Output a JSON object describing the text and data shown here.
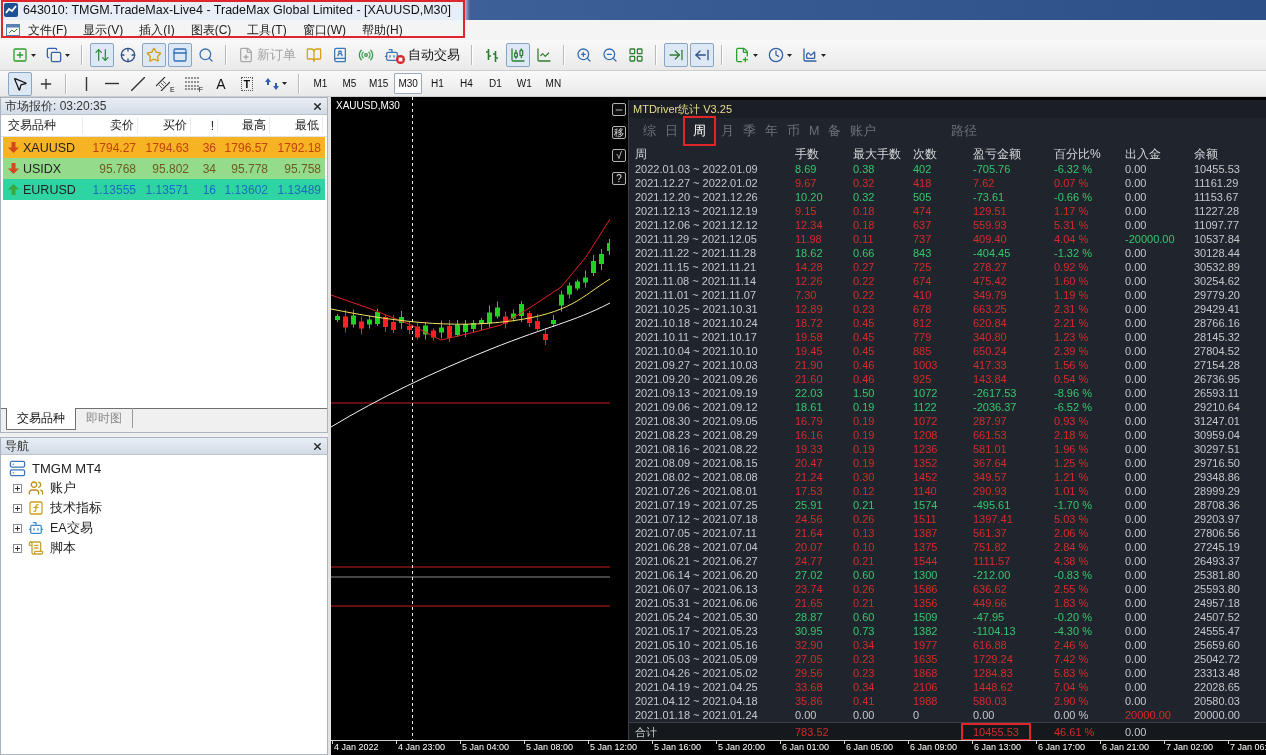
{
  "window": {
    "title": "643010: TMGM.TradeMax-Live4 - TradeMax Global Limited - [XAUUSD,M30]",
    "marked": true
  },
  "menu": [
    "文件(F)",
    "显示(V)",
    "插入(I)",
    "图表(C)",
    "工具(T)",
    "窗口(W)",
    "帮助(H)"
  ],
  "toolbar": {
    "groups": [
      [
        {
          "kind": "icon",
          "pressed": false
        },
        {
          "kind": "icon",
          "pressed": false
        }
      ],
      [
        {
          "kind": "icon",
          "pressed": true
        },
        {
          "kind": "icon",
          "pressed": false
        },
        {
          "kind": "icon",
          "pressed": true
        },
        {
          "kind": "icon",
          "pressed": true
        },
        {
          "kind": "icon",
          "pressed": false
        }
      ],
      [
        {
          "kind": "text",
          "label": "新订单",
          "disabled": true
        },
        {
          "kind": "icon",
          "pressed": false
        },
        {
          "kind": "icon",
          "pressed": false
        },
        {
          "kind": "icon",
          "pressed": false
        },
        {
          "kind": "text",
          "label": "自动交易",
          "disabled": false,
          "on": false
        }
      ],
      [
        {
          "kind": "icon",
          "pressed": false
        },
        {
          "kind": "icon",
          "pressed": true
        },
        {
          "kind": "icon",
          "pressed": false
        }
      ],
      [
        {
          "kind": "icon",
          "pressed": false
        },
        {
          "kind": "icon",
          "pressed": false
        },
        {
          "kind": "icon",
          "pressed": false
        }
      ],
      [
        {
          "kind": "icon",
          "pressed": true
        },
        {
          "kind": "icon",
          "pressed": true
        }
      ],
      [
        {
          "kind": "icon",
          "pressed": false
        },
        {
          "kind": "icon",
          "pressed": false
        },
        {
          "kind": "icon",
          "pressed": false
        }
      ]
    ]
  },
  "drawing_toolbar": {
    "groups": [
      [
        {
          "kind": "icon",
          "pressed": true
        },
        {
          "kind": "icon",
          "pressed": false
        }
      ],
      [
        {
          "kind": "icon",
          "pressed": false
        },
        {
          "kind": "icon",
          "pressed": false
        },
        {
          "kind": "icon",
          "pressed": false
        },
        {
          "kind": "icon",
          "pressed": false,
          "sub": "E"
        },
        {
          "kind": "icon",
          "pressed": false,
          "sub": "F"
        },
        {
          "kind": "letter",
          "label": "A",
          "pressed": false
        },
        {
          "kind": "boxed",
          "label": "T",
          "pressed": false
        },
        {
          "kind": "icon",
          "pressed": false
        }
      ]
    ],
    "periods": [
      {
        "label": "M1",
        "selected": false
      },
      {
        "label": "M5",
        "selected": false
      },
      {
        "label": "M15",
        "selected": false
      },
      {
        "label": "M30",
        "selected": true
      },
      {
        "label": "H1",
        "selected": false
      },
      {
        "label": "H4",
        "selected": false
      },
      {
        "label": "D1",
        "selected": false
      },
      {
        "label": "W1",
        "selected": false
      },
      {
        "label": "MN",
        "selected": false
      }
    ]
  },
  "market_watch": {
    "title": "市场报价: 03:20:35",
    "columns": [
      "交易品种",
      "卖价",
      "买价",
      "!",
      "最高",
      "最低"
    ],
    "rows": [
      {
        "symbol": "XAUUSD",
        "kind": "down",
        "color": "#f6b324",
        "quote": {
          "color": "#c2410f",
          "bid": "1794.27",
          "ask": "1794.63",
          "spread": "36",
          "high": "1796.57",
          "low": "1792.18"
        }
      },
      {
        "symbol": "USIDX",
        "kind": "down",
        "color": "#94db8b",
        "quote": {
          "color": "#6e5b22",
          "bid": "95.768",
          "ask": "95.802",
          "spread": "34",
          "high": "95.778",
          "low": "95.758"
        }
      },
      {
        "symbol": "EURUSD",
        "kind": "up",
        "color": "#2ed5a3",
        "quote": {
          "color": "#1c6cb8",
          "bid": "1.13555",
          "ask": "1.13571",
          "spread": "16",
          "high": "1.13602",
          "low": "1.13489"
        }
      }
    ],
    "tabs": [
      {
        "label": "交易品种",
        "selected": true
      },
      {
        "label": "即时图",
        "selected": false
      }
    ]
  },
  "navigator": {
    "title": "导航",
    "root": {
      "label": "TMGM MT4",
      "children": [
        {
          "label": "账户",
          "expanded": false
        },
        {
          "label": "技术指标",
          "expanded": false
        },
        {
          "label": "EA交易",
          "expanded": false
        },
        {
          "label": "脚本",
          "expanded": false
        }
      ]
    }
  },
  "chart": {
    "label": "XAUUSD,M30",
    "side_buttons": [
      {
        "kind": "icon"
      },
      {
        "kind": "text",
        "label": "移"
      },
      {
        "kind": "text",
        "label": "√"
      },
      {
        "kind": "text",
        "label": "?"
      }
    ],
    "time_labels": [
      "4 Jan 2022",
      "4 Jan 23:00",
      "5 Jan 04:00",
      "5 Jan 08:00",
      "5 Jan 12:00",
      "5 Jan 16:00",
      "5 Jan 20:00",
      "6 Jan 01:00",
      "6 Jan 05:00",
      "6 Jan 09:00",
      "6 Jan 13:00",
      "6 Jan 17:00",
      "6 Jan 21:00",
      "7 Jan 02:00",
      "7 Jan 06:"
    ]
  },
  "stats": {
    "title": "MTDriver统计 V3.25",
    "tabs": [
      {
        "label": "综",
        "selected": false,
        "marked": false
      },
      {
        "label": "日",
        "selected": false,
        "marked": false
      },
      {
        "label": "周",
        "selected": true,
        "marked": true
      },
      {
        "label": "月",
        "selected": false,
        "marked": false
      },
      {
        "label": "季",
        "selected": false,
        "marked": false
      },
      {
        "label": "年",
        "selected": false,
        "marked": false
      },
      {
        "label": "币",
        "selected": false,
        "marked": false
      },
      {
        "label": "M",
        "selected": false,
        "marked": false
      },
      {
        "label": "备",
        "selected": false,
        "marked": false
      },
      {
        "label": "账户",
        "selected": false,
        "marked": false
      },
      {
        "label": "路径",
        "selected": false,
        "marked": false
      }
    ],
    "columns": [
      "周",
      "手数",
      "最大手数",
      "次数",
      "盈亏金额",
      "百分比%",
      "出入金",
      "余额"
    ],
    "rows": [
      {
        "week": "2022.01.03 ~ 2022.01.09",
        "lots": "8.69",
        "max_lots": "0.38",
        "trades": "402",
        "profit": "-705.76",
        "percent": "-6.32 %",
        "deposit": {
          "value": "0.00",
          "kind": "none"
        },
        "balance": "10455.53",
        "kind": "loss"
      },
      {
        "week": "2021.12.27 ~ 2022.01.02",
        "lots": "9.67",
        "max_lots": "0.32",
        "trades": "418",
        "profit": "7.62",
        "percent": "0.07 %",
        "deposit": {
          "value": "0.00",
          "kind": "none"
        },
        "balance": "11161.29",
        "kind": "gain"
      },
      {
        "week": "2021.12.20 ~ 2021.12.26",
        "lots": "10.20",
        "max_lots": "0.32",
        "trades": "505",
        "profit": "-73.61",
        "percent": "-0.66 %",
        "deposit": {
          "value": "0.00",
          "kind": "none"
        },
        "balance": "11153.67",
        "kind": "loss"
      },
      {
        "week": "2021.12.13 ~ 2021.12.19",
        "lots": "9.15",
        "max_lots": "0.18",
        "trades": "474",
        "profit": "129.51",
        "percent": "1.17 %",
        "deposit": {
          "value": "0.00",
          "kind": "none"
        },
        "balance": "11227.28",
        "kind": "gain"
      },
      {
        "week": "2021.12.06 ~ 2021.12.12",
        "lots": "12.34",
        "max_lots": "0.18",
        "trades": "637",
        "profit": "559.93",
        "percent": "5.31 %",
        "deposit": {
          "value": "0.00",
          "kind": "none"
        },
        "balance": "11097.77",
        "kind": "gain"
      },
      {
        "week": "2021.11.29 ~ 2021.12.05",
        "lots": "11.98",
        "max_lots": "0.11",
        "trades": "737",
        "profit": "409.40",
        "percent": "4.04 %",
        "deposit": {
          "value": "-20000.00",
          "kind": "out"
        },
        "balance": "10537.84",
        "kind": "gain"
      },
      {
        "week": "2021.11.22 ~ 2021.11.28",
        "lots": "18.62",
        "max_lots": "0.66",
        "trades": "843",
        "profit": "-404.45",
        "percent": "-1.32 %",
        "deposit": {
          "value": "0.00",
          "kind": "none"
        },
        "balance": "30128.44",
        "kind": "loss"
      },
      {
        "week": "2021.11.15 ~ 2021.11.21",
        "lots": "14.28",
        "max_lots": "0.27",
        "trades": "725",
        "profit": "278.27",
        "percent": "0.92 %",
        "deposit": {
          "value": "0.00",
          "kind": "none"
        },
        "balance": "30532.89",
        "kind": "gain"
      },
      {
        "week": "2021.11.08 ~ 2021.11.14",
        "lots": "12.26",
        "max_lots": "0.22",
        "trades": "674",
        "profit": "475.42",
        "percent": "1.60 %",
        "deposit": {
          "value": "0.00",
          "kind": "none"
        },
        "balance": "30254.62",
        "kind": "gain"
      },
      {
        "week": "2021.11.01 ~ 2021.11.07",
        "lots": "7.30",
        "max_lots": "0.22",
        "trades": "410",
        "profit": "349.79",
        "percent": "1.19 %",
        "deposit": {
          "value": "0.00",
          "kind": "none"
        },
        "balance": "29779.20",
        "kind": "gain"
      },
      {
        "week": "2021.10.25 ~ 2021.10.31",
        "lots": "12.89",
        "max_lots": "0.23",
        "trades": "678",
        "profit": "663.25",
        "percent": "2.31 %",
        "deposit": {
          "value": "0.00",
          "kind": "none"
        },
        "balance": "29429.41",
        "kind": "gain"
      },
      {
        "week": "2021.10.18 ~ 2021.10.24",
        "lots": "18.72",
        "max_lots": "0.45",
        "trades": "812",
        "profit": "620.84",
        "percent": "2.21 %",
        "deposit": {
          "value": "0.00",
          "kind": "none"
        },
        "balance": "28766.16",
        "kind": "gain"
      },
      {
        "week": "2021.10.11 ~ 2021.10.17",
        "lots": "19.58",
        "max_lots": "0.45",
        "trades": "779",
        "profit": "340.80",
        "percent": "1.23 %",
        "deposit": {
          "value": "0.00",
          "kind": "none"
        },
        "balance": "28145.32",
        "kind": "gain"
      },
      {
        "week": "2021.10.04 ~ 2021.10.10",
        "lots": "19.45",
        "max_lots": "0.45",
        "trades": "885",
        "profit": "650.24",
        "percent": "2.39 %",
        "deposit": {
          "value": "0.00",
          "kind": "none"
        },
        "balance": "27804.52",
        "kind": "gain"
      },
      {
        "week": "2021.09.27 ~ 2021.10.03",
        "lots": "21.90",
        "max_lots": "0.46",
        "trades": "1003",
        "profit": "417.33",
        "percent": "1.56 %",
        "deposit": {
          "value": "0.00",
          "kind": "none"
        },
        "balance": "27154.28",
        "kind": "gain"
      },
      {
        "week": "2021.09.20 ~ 2021.09.26",
        "lots": "21.60",
        "max_lots": "0.46",
        "trades": "925",
        "profit": "143.84",
        "percent": "0.54 %",
        "deposit": {
          "value": "0.00",
          "kind": "none"
        },
        "balance": "26736.95",
        "kind": "gain"
      },
      {
        "week": "2021.09.13 ~ 2021.09.19",
        "lots": "22.03",
        "max_lots": "1.50",
        "trades": "1072",
        "profit": "-2617.53",
        "percent": "-8.96 %",
        "deposit": {
          "value": "0.00",
          "kind": "none"
        },
        "balance": "26593.11",
        "kind": "loss"
      },
      {
        "week": "2021.09.06 ~ 2021.09.12",
        "lots": "18.61",
        "max_lots": "0.19",
        "trades": "1122",
        "profit": "-2036.37",
        "percent": "-6.52 %",
        "deposit": {
          "value": "0.00",
          "kind": "none"
        },
        "balance": "29210.64",
        "kind": "loss"
      },
      {
        "week": "2021.08.30 ~ 2021.09.05",
        "lots": "16.79",
        "max_lots": "0.19",
        "trades": "1072",
        "profit": "287.97",
        "percent": "0.93 %",
        "deposit": {
          "value": "0.00",
          "kind": "none"
        },
        "balance": "31247.01",
        "kind": "gain"
      },
      {
        "week": "2021.08.23 ~ 2021.08.29",
        "lots": "16.16",
        "max_lots": "0.19",
        "trades": "1208",
        "profit": "661.53",
        "percent": "2.18 %",
        "deposit": {
          "value": "0.00",
          "kind": "none"
        },
        "balance": "30959.04",
        "kind": "gain"
      },
      {
        "week": "2021.08.16 ~ 2021.08.22",
        "lots": "19.33",
        "max_lots": "0.19",
        "trades": "1236",
        "profit": "581.01",
        "percent": "1.96 %",
        "deposit": {
          "value": "0.00",
          "kind": "none"
        },
        "balance": "30297.51",
        "kind": "gain"
      },
      {
        "week": "2021.08.09 ~ 2021.08.15",
        "lots": "20.47",
        "max_lots": "0.19",
        "trades": "1352",
        "profit": "367.64",
        "percent": "1.25 %",
        "deposit": {
          "value": "0.00",
          "kind": "none"
        },
        "balance": "29716.50",
        "kind": "gain"
      },
      {
        "week": "2021.08.02 ~ 2021.08.08",
        "lots": "21.24",
        "max_lots": "0.30",
        "trades": "1452",
        "profit": "349.57",
        "percent": "1.21 %",
        "deposit": {
          "value": "0.00",
          "kind": "none"
        },
        "balance": "29348.86",
        "kind": "gain"
      },
      {
        "week": "2021.07.26 ~ 2021.08.01",
        "lots": "17.53",
        "max_lots": "0.12",
        "trades": "1140",
        "profit": "290.93",
        "percent": "1.01 %",
        "deposit": {
          "value": "0.00",
          "kind": "none"
        },
        "balance": "28999.29",
        "kind": "gain"
      },
      {
        "week": "2021.07.19 ~ 2021.07.25",
        "lots": "25.91",
        "max_lots": "0.21",
        "trades": "1574",
        "profit": "-495.61",
        "percent": "-1.70 %",
        "deposit": {
          "value": "0.00",
          "kind": "none"
        },
        "balance": "28708.36",
        "kind": "loss"
      },
      {
        "week": "2021.07.12 ~ 2021.07.18",
        "lots": "24.56",
        "max_lots": "0.26",
        "trades": "1511",
        "profit": "1397.41",
        "percent": "5.03 %",
        "deposit": {
          "value": "0.00",
          "kind": "none"
        },
        "balance": "29203.97",
        "kind": "gain"
      },
      {
        "week": "2021.07.05 ~ 2021.07.11",
        "lots": "21.64",
        "max_lots": "0.13",
        "trades": "1387",
        "profit": "561.37",
        "percent": "2.06 %",
        "deposit": {
          "value": "0.00",
          "kind": "none"
        },
        "balance": "27806.56",
        "kind": "gain"
      },
      {
        "week": "2021.06.28 ~ 2021.07.04",
        "lots": "20.07",
        "max_lots": "0.10",
        "trades": "1375",
        "profit": "751.82",
        "percent": "2.84 %",
        "deposit": {
          "value": "0.00",
          "kind": "none"
        },
        "balance": "27245.19",
        "kind": "gain"
      },
      {
        "week": "2021.06.21 ~ 2021.06.27",
        "lots": "24.77",
        "max_lots": "0.21",
        "trades": "1544",
        "profit": "1111.57",
        "percent": "4.38 %",
        "deposit": {
          "value": "0.00",
          "kind": "none"
        },
        "balance": "26493.37",
        "kind": "gain"
      },
      {
        "week": "2021.06.14 ~ 2021.06.20",
        "lots": "27.02",
        "max_lots": "0.60",
        "trades": "1300",
        "profit": "-212.00",
        "percent": "-0.83 %",
        "deposit": {
          "value": "0.00",
          "kind": "none"
        },
        "balance": "25381.80",
        "kind": "loss"
      },
      {
        "week": "2021.06.07 ~ 2021.06.13",
        "lots": "23.74",
        "max_lots": "0.26",
        "trades": "1586",
        "profit": "636.62",
        "percent": "2.55 %",
        "deposit": {
          "value": "0.00",
          "kind": "none"
        },
        "balance": "25593.80",
        "kind": "gain"
      },
      {
        "week": "2021.05.31 ~ 2021.06.06",
        "lots": "21.65",
        "max_lots": "0.21",
        "trades": "1356",
        "profit": "449.66",
        "percent": "1.83 %",
        "deposit": {
          "value": "0.00",
          "kind": "none"
        },
        "balance": "24957.18",
        "kind": "gain"
      },
      {
        "week": "2021.05.24 ~ 2021.05.30",
        "lots": "28.87",
        "max_lots": "0.60",
        "trades": "1509",
        "profit": "-47.95",
        "percent": "-0.20 %",
        "deposit": {
          "value": "0.00",
          "kind": "none"
        },
        "balance": "24507.52",
        "kind": "loss"
      },
      {
        "week": "2021.05.17 ~ 2021.05.23",
        "lots": "30.95",
        "max_lots": "0.73",
        "trades": "1382",
        "profit": "-1104.13",
        "percent": "-4.30 %",
        "deposit": {
          "value": "0.00",
          "kind": "none"
        },
        "balance": "24555.47",
        "kind": "loss"
      },
      {
        "week": "2021.05.10 ~ 2021.05.16",
        "lots": "32.90",
        "max_lots": "0.34",
        "trades": "1977",
        "profit": "616.88",
        "percent": "2.46 %",
        "deposit": {
          "value": "0.00",
          "kind": "none"
        },
        "balance": "25659.60",
        "kind": "gain"
      },
      {
        "week": "2021.05.03 ~ 2021.05.09",
        "lots": "27.05",
        "max_lots": "0.23",
        "trades": "1635",
        "profit": "1729.24",
        "percent": "7.42 %",
        "deposit": {
          "value": "0.00",
          "kind": "none"
        },
        "balance": "25042.72",
        "kind": "gain"
      },
      {
        "week": "2021.04.26 ~ 2021.05.02",
        "lots": "29.56",
        "max_lots": "0.23",
        "trades": "1868",
        "profit": "1284.83",
        "percent": "5.83 %",
        "deposit": {
          "value": "0.00",
          "kind": "none"
        },
        "balance": "23313.48",
        "kind": "gain"
      },
      {
        "week": "2021.04.19 ~ 2021.04.25",
        "lots": "33.68",
        "max_lots": "0.34",
        "trades": "2106",
        "profit": "1448.62",
        "percent": "7.04 %",
        "deposit": {
          "value": "0.00",
          "kind": "none"
        },
        "balance": "22028.65",
        "kind": "gain"
      },
      {
        "week": "2021.04.12 ~ 2021.04.18",
        "lots": "35.86",
        "max_lots": "0.41",
        "trades": "1988",
        "profit": "580.03",
        "percent": "2.90 %",
        "deposit": {
          "value": "0.00",
          "kind": "none"
        },
        "balance": "20580.03",
        "kind": "gain"
      },
      {
        "week": "2021.01.18 ~ 2021.01.24",
        "lots": "0.00",
        "max_lots": "0.00",
        "trades": "0",
        "profit": "0.00",
        "percent": "0.00 %",
        "deposit": {
          "value": "20000.00",
          "kind": "in"
        },
        "balance": "20000.00",
        "kind": "none"
      }
    ],
    "total": {
      "label": "合计",
      "lots": "783.52",
      "profit": "10455.53",
      "percent": "46.61 %",
      "deposit": "0.00",
      "kind": "gain",
      "marked": true
    }
  }
}
